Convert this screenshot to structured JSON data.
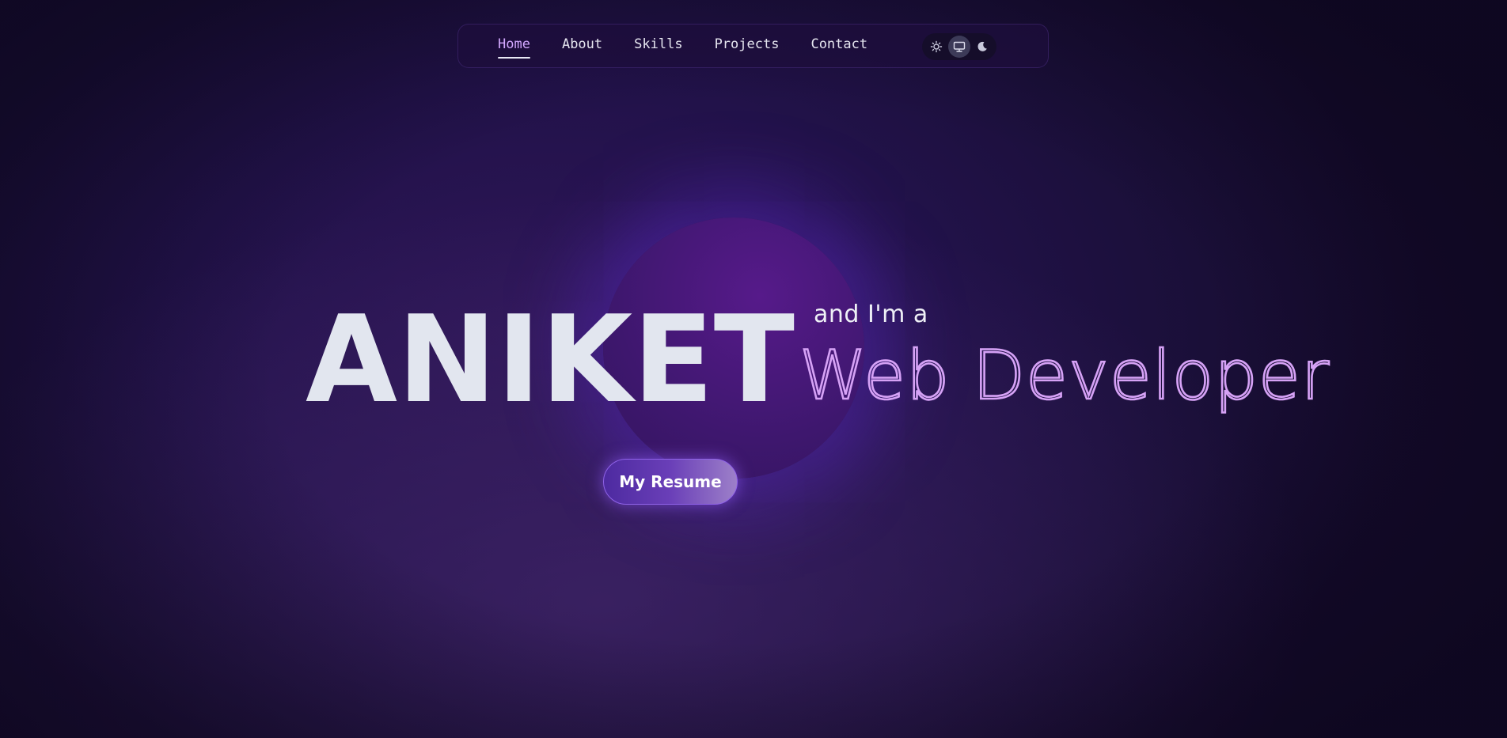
{
  "nav": {
    "links": [
      {
        "label": "Home",
        "active": true
      },
      {
        "label": "About",
        "active": false
      },
      {
        "label": "Skills",
        "active": false
      },
      {
        "label": "Projects",
        "active": false
      },
      {
        "label": "Contact",
        "active": false
      }
    ],
    "theme": {
      "options": [
        "sun-icon",
        "monitor-icon",
        "moon-icon"
      ],
      "selected": "monitor-icon"
    }
  },
  "hero": {
    "name": "ANIKET",
    "intro": "and I'm a",
    "role": "Web Developer",
    "resume_button": "My Resume"
  },
  "colors": {
    "accent": "#d3a8ff",
    "role_text": "#d6a2f6",
    "background": "#1b0f3a",
    "name_text": "#e2e6ef"
  }
}
